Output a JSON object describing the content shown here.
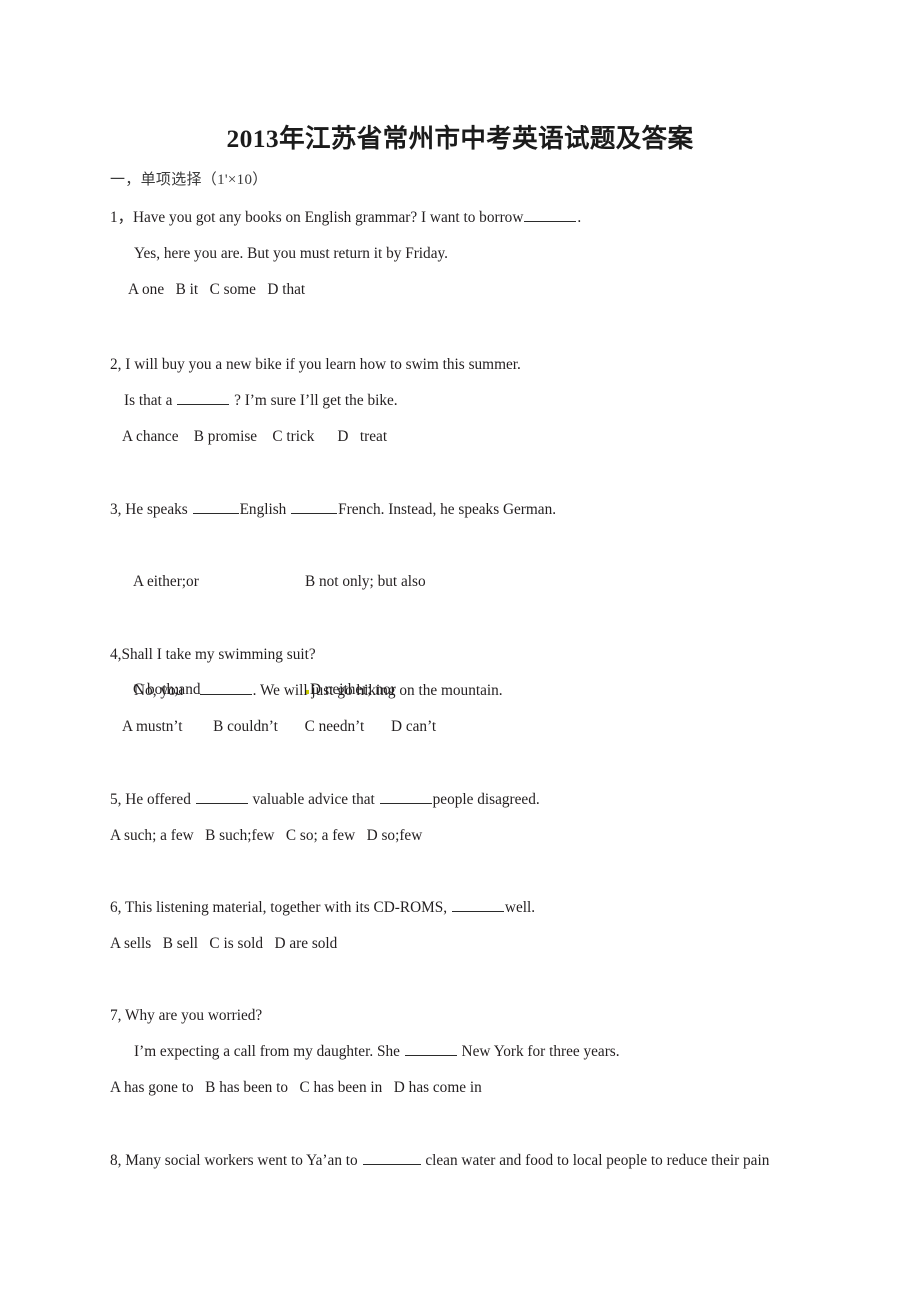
{
  "document": {
    "title": "2013年江苏省常州市中考英语试题及答案",
    "section_heading": "一，单项选择（1'×10）"
  },
  "questions": [
    {
      "stem": "1，Have you got any books on English grammar? I want to borrow",
      "stem_tail": ".",
      "reply": "Yes, here you are. But you must return it by Friday.",
      "options_line": "A one   B it   C some   D that"
    },
    {
      "stem": "2, I will buy you a new bike if you learn how to swim this summer.",
      "reply_pre": "Is that a ",
      "reply_post": " ? I’m sure I’ll get the bike.",
      "options_line": "A chance    B promise    C trick      D   treat"
    },
    {
      "stem_pre": "3, He speaks ",
      "stem_mid": "English ",
      "stem_post": "French. Instead, he speaks German.",
      "option_a": "A either;or",
      "option_b": "B not only; but also",
      "option_c": "C both;and",
      "option_d": "D neither; nor"
    },
    {
      "stem": "4,Shall I take my swimming suit?",
      "reply_pre": "No, you    ",
      "reply_post": ". We will just go hiking on the mountain.",
      "options_line": "A mustn’t        B couldn’t       C needn’t       D can’t"
    },
    {
      "stem_pre": "5, He offered ",
      "stem_mid": " valuable advice that ",
      "stem_post": "people disagreed.",
      "options_line": "A such; a few   B such;few   C so; a few   D so;few"
    },
    {
      "stem_pre": "6, This listening material, together with its CD-ROMS, ",
      "stem_post": "well.",
      "options_line": "A sells   B sell   C is sold   D are sold"
    },
    {
      "stem": "7, Why are you worried?",
      "reply_pre": "I’m expecting a call from my daughter. She ",
      "reply_post": " New York for three years.",
      "options_line": "A has gone to   B has been to   C has been in   D has come in"
    },
    {
      "stem_pre": "8, Many social workers went to Ya’an to ",
      "stem_post": " clean water and food to local people to reduce their pain"
    }
  ]
}
